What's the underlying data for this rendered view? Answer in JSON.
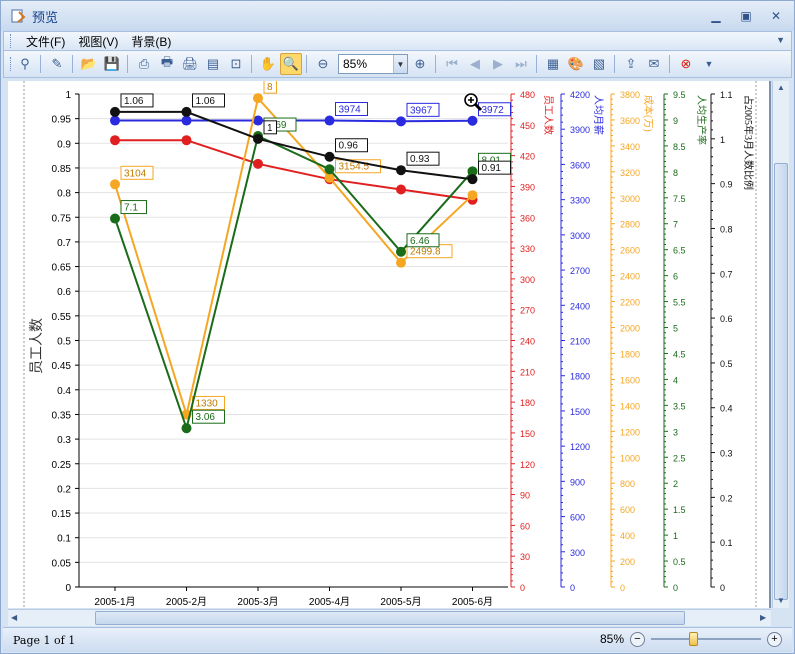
{
  "window": {
    "title": "预览"
  },
  "menu": [
    {
      "label": "文件(F)"
    },
    {
      "label": "视图(V)"
    },
    {
      "label": "背景(B)"
    }
  ],
  "toolbar": {
    "zoom_value": "85%"
  },
  "status": {
    "page_info": "Page 1 of 1",
    "zoom": "85%",
    "zoom_slider_fraction": 0.38
  },
  "colors": {
    "red": "#e02020",
    "blue": "#2a2adf",
    "orange": "#f5a623",
    "green": "#1a6b1a",
    "black": "#111111"
  },
  "chart_data": {
    "type": "line",
    "categories": [
      "2005-1月",
      "2005-2月",
      "2005-3月",
      "2005-4月",
      "2005-5月",
      "2005-6月"
    ],
    "ylabel": "员工人数",
    "series": [
      {
        "name": "员工人数",
        "axis": "right1",
        "color": "#e02020",
        "values": [
          435,
          435,
          412,
          397,
          387,
          377
        ]
      },
      {
        "name": "人均月薪",
        "axis": "right2",
        "color": "#2a2adf",
        "values": [
          3974,
          3974,
          3974,
          3974,
          3967,
          3972
        ],
        "labels": [
          "",
          "",
          "",
          "3974",
          "3967",
          "3972"
        ]
      },
      {
        "name": "成本(万)",
        "axis": "right3",
        "color": "#f5a623",
        "values": [
          3104,
          1330,
          3768,
          3154.5,
          2499.8,
          3020
        ],
        "labels": [
          "3104",
          "1330",
          "8",
          "3154.5",
          "2499.8",
          ""
        ]
      },
      {
        "name": "人均生产率",
        "axis": "right4",
        "color": "#1a6b1a",
        "values": [
          7.1,
          3.06,
          8.69,
          8.05,
          6.46,
          8.01
        ],
        "labels": [
          "7.1",
          "3.06",
          "8.69",
          "",
          "6.46",
          "8.01"
        ]
      },
      {
        "name": "占2005年3月人数比例",
        "axis": "right5",
        "color": "#111111",
        "values": [
          1.06,
          1.06,
          1.0,
          0.96,
          0.93,
          0.91
        ],
        "labels": [
          "1.06",
          "1.06",
          "1",
          "0.96",
          "0.93",
          "0.91"
        ]
      }
    ],
    "axes": {
      "left": {
        "min": 0,
        "max": 1,
        "step": 0.05,
        "label": "员工人数"
      },
      "right1": {
        "min": 0,
        "max": 480,
        "step": 30,
        "label": "员工人数",
        "color": "#e02020"
      },
      "right2": {
        "min": 0,
        "max": 4200,
        "step": 300,
        "label": "人均月薪",
        "color": "#2a2adf"
      },
      "right3": {
        "min": 0,
        "max": 3800,
        "step": 200,
        "label": "成本(万)",
        "color": "#f5a623"
      },
      "right4": {
        "min": 0,
        "max": 9.5,
        "step": 0.5,
        "label": "人均生产率",
        "color": "#1a6b1a"
      },
      "right5": {
        "min": 0,
        "max": 1.1,
        "step": 0.1,
        "label": "占2005年3月人数比例",
        "color": "#111111"
      }
    },
    "grid": true
  }
}
